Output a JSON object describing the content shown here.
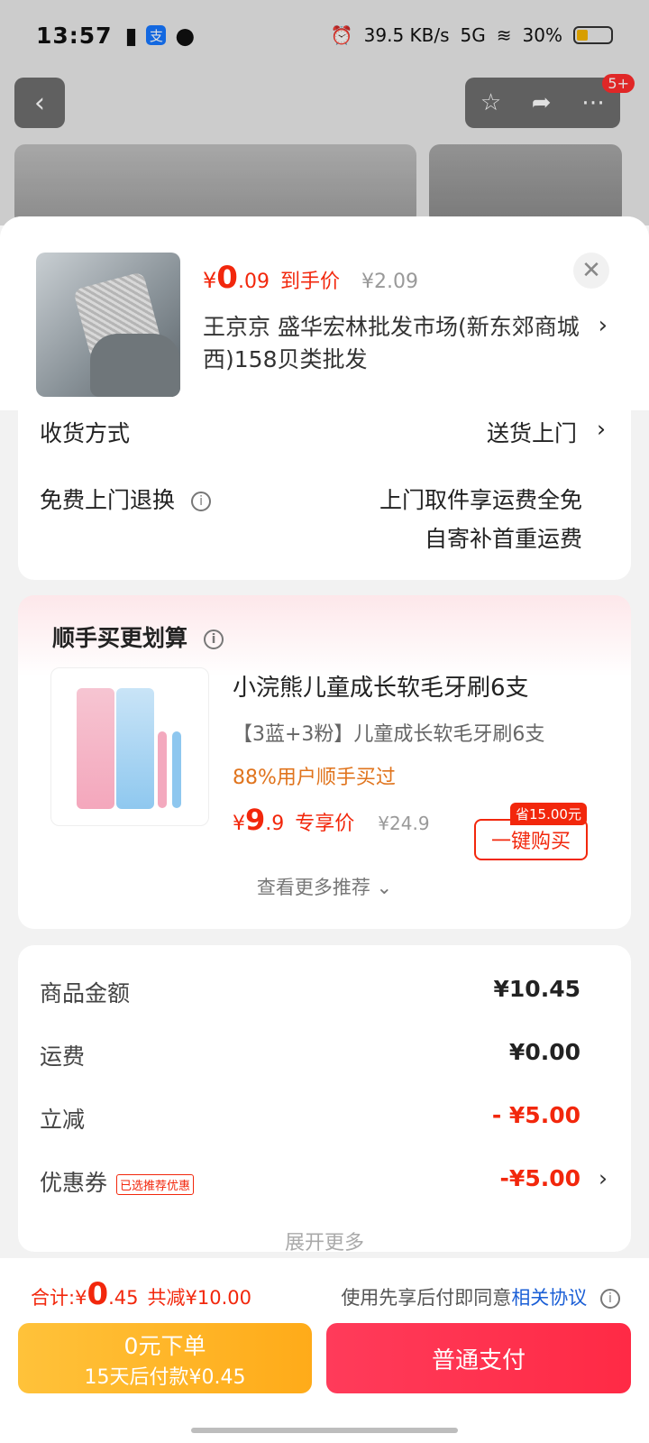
{
  "status_bar": {
    "time": "13:57",
    "speed": "39.5 KB/s",
    "network": "5G",
    "battery": "30%"
  },
  "background": {
    "badge": "5+"
  },
  "product": {
    "price_yen": "¥",
    "price_int": "0",
    "price_dec": ".09",
    "price_tag": "到手价",
    "orig_price": "¥2.09",
    "address": "王京京  盛华宏林批发市场(新东郊商城西)158贝类批发"
  },
  "shipping": {
    "method_label": "收货方式",
    "method_value": "送货上门",
    "return_label": "免费上门退换",
    "return_line1": "上门取件享运费全免",
    "return_line2": "自寄补首重运费"
  },
  "recommend": {
    "title": "顺手买更划算",
    "name": "小浣熊儿童成长软毛牙刷6支",
    "desc": "【3蓝+3粉】儿童成长软毛牙刷6支",
    "rate": "88%用户顺手买过",
    "price_yen": "¥",
    "price_int": "9",
    "price_dec": ".9",
    "price_tag": "专享价",
    "orig_price": "¥24.9",
    "save_badge": "省15.00元",
    "buy_label": "一键购买",
    "more_label": "查看更多推荐 ⌄"
  },
  "summary": {
    "goods_label": "商品金额",
    "goods_value": "¥10.45",
    "freight_label": "运费",
    "freight_value": "¥0.00",
    "discount_label": "立减",
    "discount_value": "- ¥5.00",
    "coupon_label": "优惠券",
    "coupon_tag": "已选推荐优惠",
    "coupon_value": "-¥5.00",
    "expand_label": "展开更多"
  },
  "footer": {
    "total_label": "合计: ",
    "total_yen": "¥",
    "total_int": "0",
    "total_dec": ".45",
    "total_cut": "共减¥10.00",
    "agree_text": "使用先享后付即同意",
    "agree_link": "相关协议",
    "zero_line1": "0元下单",
    "zero_line2": "15天后付款¥0.45",
    "pay_label": "普通支付"
  }
}
